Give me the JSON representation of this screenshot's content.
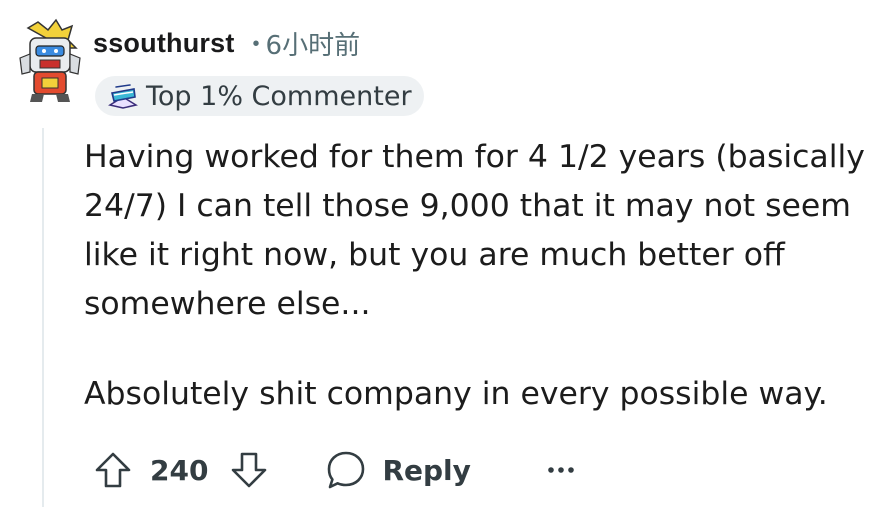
{
  "comment": {
    "username": "ssouthurst",
    "separator": "•",
    "timestamp": "6小时前",
    "badge": {
      "icon": "top-commenter-icon",
      "label": "Top 1% Commenter"
    },
    "paragraphs": [
      "Having worked for them for 4 1/2 years (basically 24/7) I can tell those 9,000 that it may not seem like it right now, but you are much better off somewhere else...",
      "Absolutely shit company in every possible way."
    ],
    "actions": {
      "score": "240",
      "reply_label": "Reply",
      "upvote_icon": "upvote-arrow-icon",
      "downvote_icon": "downvote-arrow-icon",
      "reply_icon": "speech-bubble-icon",
      "more_icon": "ellipsis-icon"
    }
  },
  "colors": {
    "text": "#1c1c1c",
    "meta": "#576f76",
    "badge_bg": "#eef1f3",
    "thread_line": "#e5ebee"
  }
}
